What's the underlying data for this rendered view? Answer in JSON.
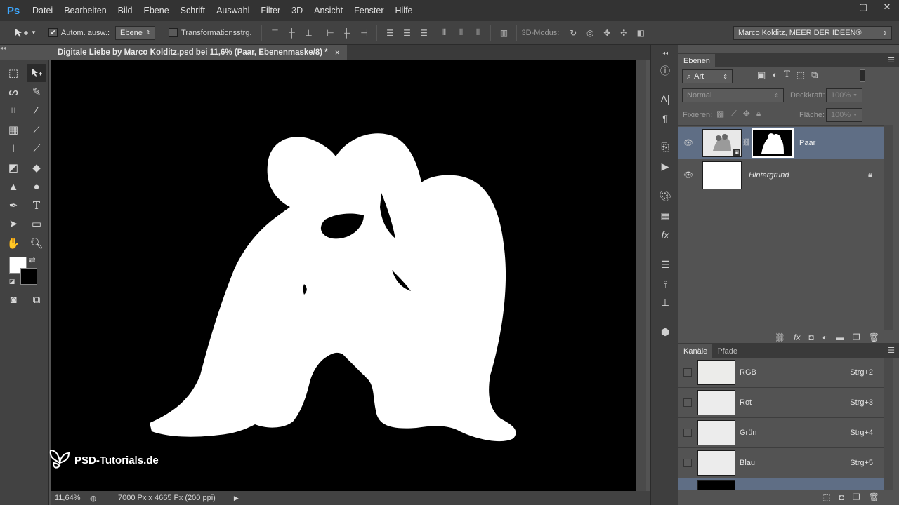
{
  "app": {
    "logo": "Ps"
  },
  "menu": [
    "Datei",
    "Bearbeiten",
    "Bild",
    "Ebene",
    "Schrift",
    "Auswahl",
    "Filter",
    "3D",
    "Ansicht",
    "Fenster",
    "Hilfe"
  ],
  "window_controls": {
    "minimize": "—",
    "maximize": "▢",
    "close": "✕"
  },
  "options": {
    "auto_select_label": "Autom. ausw.:",
    "auto_select_checked": "✔",
    "auto_select_target": "Ebene",
    "transform_label": "Transformationsstrg.",
    "mode_3d_label": "3D-Modus:",
    "workspace": "Marco Kolditz, MEER DER IDEEN®"
  },
  "document": {
    "tab_title": "Digitale Liebe by Marco Kolditz.psd bei 11,6% (Paar, Ebenenmaske/8) *",
    "tab_close": "×",
    "zoom": "11,64%",
    "doc_info": "7000 Px x 4665 Px (200 ppi)",
    "watermark": "PSD-Tutorials.de"
  },
  "layers_panel": {
    "tab": "Ebenen",
    "filter_kind": "Art",
    "blend_mode": "Normal",
    "opacity_label": "Deckkraft:",
    "opacity_value": "100%",
    "lock_label": "Fixieren:",
    "fill_label": "Fläche:",
    "fill_value": "100%",
    "layers": [
      {
        "name": "Paar",
        "selected": true
      },
      {
        "name": "Hintergrund",
        "locked": true
      }
    ]
  },
  "channels_panel": {
    "tabs": [
      "Kanäle",
      "Pfade"
    ],
    "channels": [
      {
        "name": "RGB",
        "shortcut": "Strg+2"
      },
      {
        "name": "Rot",
        "shortcut": "Strg+3"
      },
      {
        "name": "Grün",
        "shortcut": "Strg+4"
      },
      {
        "name": "Blau",
        "shortcut": "Strg+5"
      }
    ]
  },
  "colors": {
    "accent": "#3ea8ff",
    "selected_layer": "#5f6e85",
    "foreground": "#ffffff",
    "background": "#000000"
  }
}
